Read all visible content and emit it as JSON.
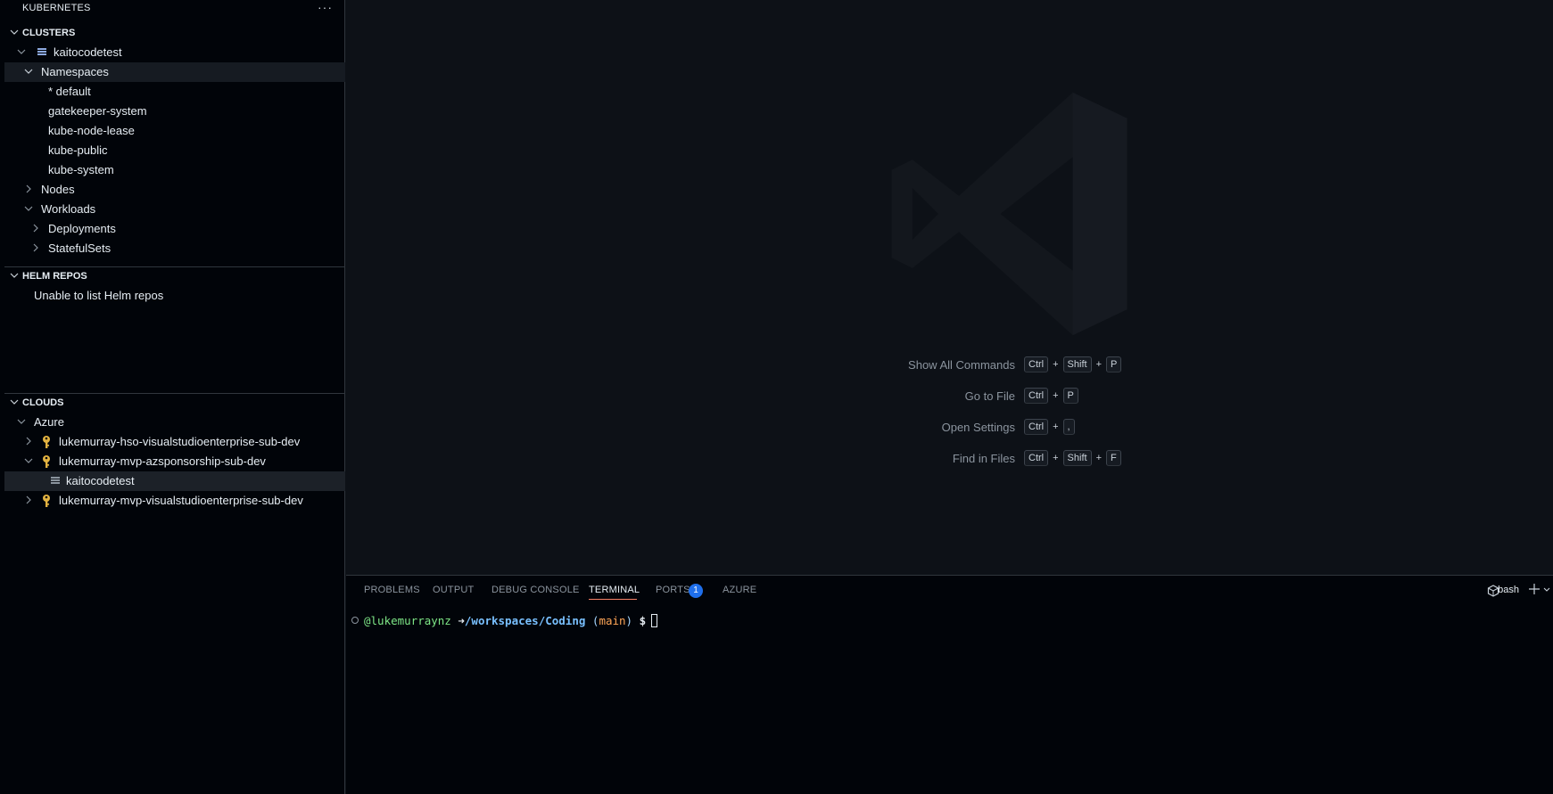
{
  "sidebar": {
    "title": "KUBERNETES",
    "more": "···",
    "clusters": {
      "header": "CLUSTERS",
      "cluster": "kaitocodetest",
      "namespaces_label": "Namespaces",
      "namespaces": [
        "* default",
        "gatekeeper-system",
        "kube-node-lease",
        "kube-public",
        "kube-system"
      ],
      "nodes_label": "Nodes",
      "workloads_label": "Workloads",
      "workloads": [
        "Deployments",
        "StatefulSets"
      ]
    },
    "helm": {
      "header": "HELM REPOS",
      "message": "Unable to list Helm repos"
    },
    "clouds": {
      "header": "CLOUDS",
      "provider": "Azure",
      "subscriptions": [
        "lukemurray-hso-visualstudioenterprise-sub-dev",
        "lukemurray-mvp-azsponsorship-sub-dev",
        "lukemurray-mvp-visualstudioenterprise-sub-dev"
      ],
      "cluster": "kaitocodetest"
    }
  },
  "editor": {
    "shortcuts": [
      {
        "label": "Show All Commands",
        "keys": [
          "Ctrl",
          "Shift",
          "P"
        ]
      },
      {
        "label": "Go to File",
        "keys": [
          "Ctrl",
          "P"
        ]
      },
      {
        "label": "Open Settings",
        "keys": [
          "Ctrl",
          ","
        ]
      },
      {
        "label": "Find in Files",
        "keys": [
          "Ctrl",
          "Shift",
          "F"
        ]
      }
    ]
  },
  "panel": {
    "tabs": {
      "problems": "PROBLEMS",
      "output": "OUTPUT",
      "debug": "DEBUG CONSOLE",
      "terminal": "TERMINAL",
      "ports": "PORTS",
      "ports_badge": "1",
      "azure": "AZURE"
    },
    "shell": "bash",
    "terminal": {
      "user": "@lukemurraynz",
      "arrow": "➜",
      "path": "/workspaces/Coding",
      "branch": "main",
      "prompt": "$"
    }
  },
  "colors": {
    "accent": "#f78166",
    "key_icon": "#e3b341",
    "badge": "#1f6feb"
  }
}
